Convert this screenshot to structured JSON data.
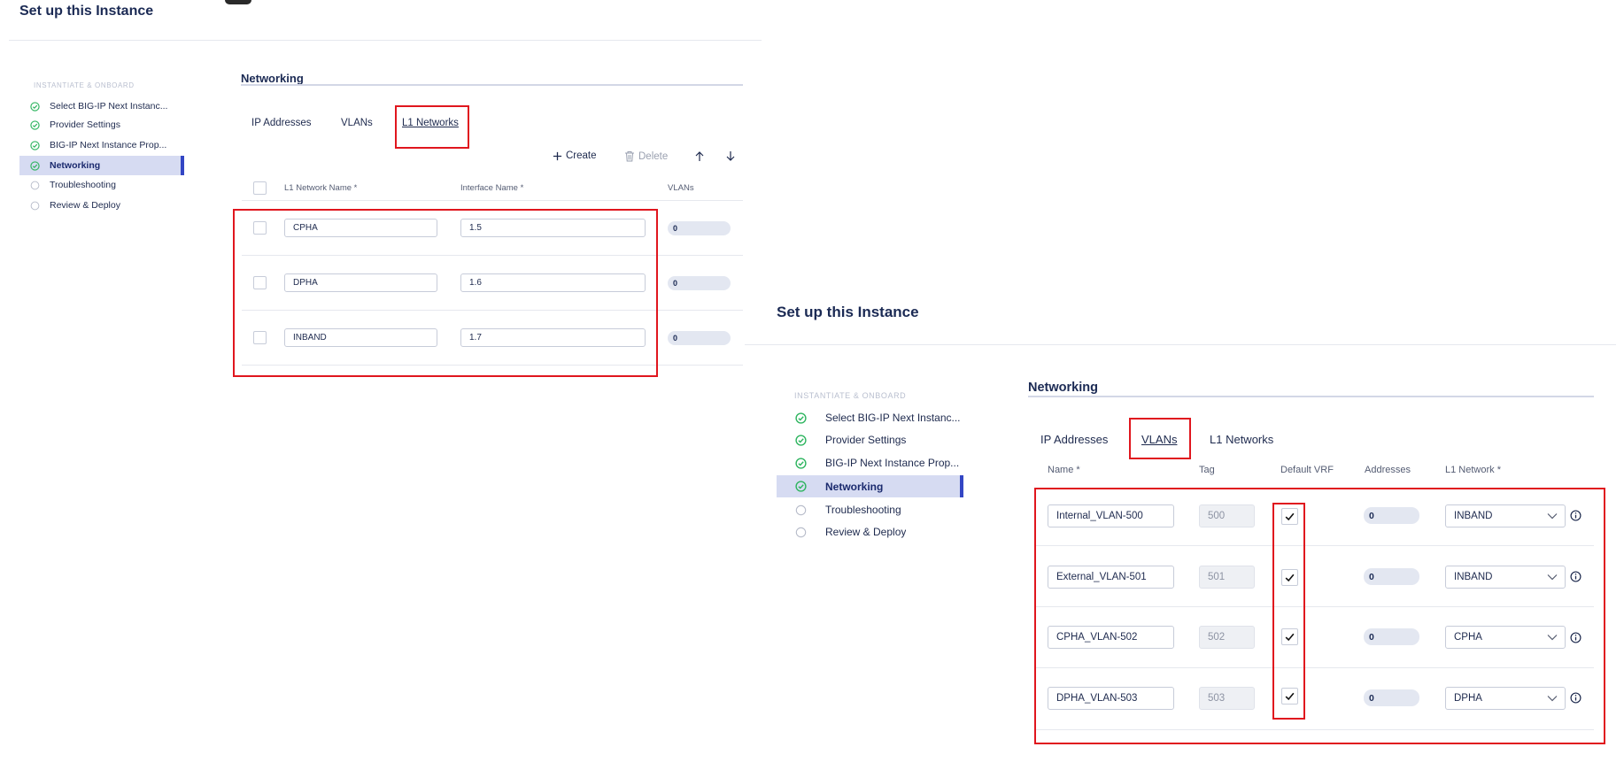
{
  "left": {
    "title": "Set up this Instance",
    "steps_heading": "INSTANTIATE & ONBOARD",
    "steps": [
      {
        "label": "Select BIG-IP Next Instanc...",
        "status": "done"
      },
      {
        "label": "Provider Settings",
        "status": "done"
      },
      {
        "label": "BIG-IP Next Instance Prop...",
        "status": "done"
      },
      {
        "label": "Networking",
        "status": "active"
      },
      {
        "label": "Troubleshooting",
        "status": "pending"
      },
      {
        "label": "Review & Deploy",
        "status": "pending"
      }
    ],
    "section_title": "Networking",
    "tabs": [
      "IP Addresses",
      "VLANs",
      "L1 Networks"
    ],
    "selected_tab": "L1 Networks",
    "toolbar": {
      "create": "Create",
      "delete": "Delete"
    },
    "columns": [
      "L1 Network Name *",
      "Interface Name *",
      "VLANs"
    ],
    "rows": [
      {
        "name": "CPHA",
        "interface": "1.5",
        "vlans": "0"
      },
      {
        "name": "DPHA",
        "interface": "1.6",
        "vlans": "0"
      },
      {
        "name": "INBAND",
        "interface": "1.7",
        "vlans": "0"
      }
    ]
  },
  "right": {
    "title": "Set up this Instance",
    "steps_heading": "INSTANTIATE & ONBOARD",
    "steps": [
      {
        "label": "Select BIG-IP Next Instanc...",
        "status": "done"
      },
      {
        "label": "Provider Settings",
        "status": "done"
      },
      {
        "label": "BIG-IP Next Instance Prop...",
        "status": "done"
      },
      {
        "label": "Networking",
        "status": "active"
      },
      {
        "label": "Troubleshooting",
        "status": "pending"
      },
      {
        "label": "Review & Deploy",
        "status": "pending"
      }
    ],
    "section_title": "Networking",
    "tabs": [
      "IP Addresses",
      "VLANs",
      "L1 Networks"
    ],
    "selected_tab": "VLANs",
    "columns": [
      "Name *",
      "Tag",
      "Default VRF",
      "Addresses",
      "L1 Network *"
    ],
    "rows": [
      {
        "name": "Internal_VLAN-500",
        "tag": "500",
        "default_vrf": true,
        "addresses": "0",
        "l1_network": "INBAND"
      },
      {
        "name": "External_VLAN-501",
        "tag": "501",
        "default_vrf": true,
        "addresses": "0",
        "l1_network": "INBAND"
      },
      {
        "name": "CPHA_VLAN-502",
        "tag": "502",
        "default_vrf": true,
        "addresses": "0",
        "l1_network": "CPHA"
      },
      {
        "name": "DPHA_VLAN-503",
        "tag": "503",
        "default_vrf": true,
        "addresses": "0",
        "l1_network": "DPHA"
      }
    ]
  },
  "colors": {
    "accent": "#3346c4",
    "active_bg": "#d6dbf2",
    "success": "#2fb560",
    "highlight_box": "#e0161e"
  },
  "icons": [
    "check-circle-icon",
    "circle-outline-icon",
    "plus-icon",
    "trash-icon",
    "arrow-up-icon",
    "arrow-down-icon",
    "checkmark-icon",
    "chevron-down-icon",
    "info-icon"
  ]
}
